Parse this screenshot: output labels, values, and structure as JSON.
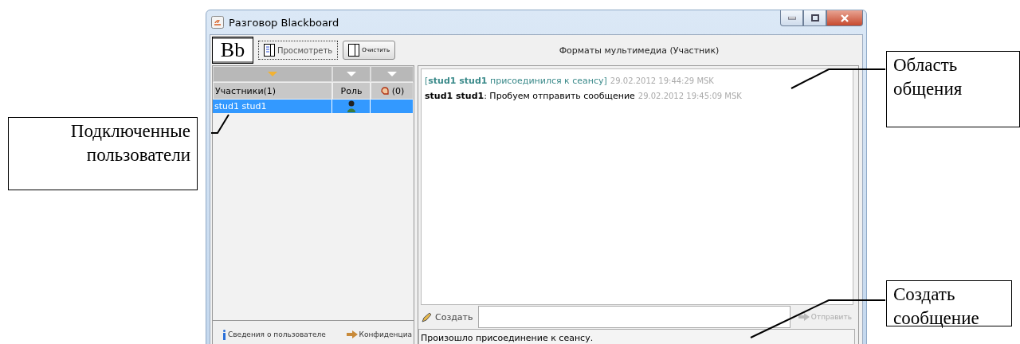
{
  "window": {
    "title": "Разговор Blackboard"
  },
  "toolbar": {
    "logo": "Bb",
    "buttons": [
      {
        "label": "Просмотреть",
        "focused": true
      },
      {
        "label": "Очистить",
        "focused": false
      }
    ],
    "caption": "Форматы мультимедиа (Участник)"
  },
  "participants": {
    "columns": [
      {
        "label": "Участники(1)",
        "sorted": true
      },
      {
        "label": "Роль",
        "sorted": false
      },
      {
        "label": "(0)",
        "sorted": false
      }
    ],
    "rows": [
      {
        "name": "stud1 stud1",
        "selected": true
      }
    ],
    "links": [
      "Сведения о пользователе",
      "Конфиденциа"
    ]
  },
  "chat": {
    "messages": [
      {
        "kind": "system",
        "body": "[**stud1 stud1** присоединился к сеансу]",
        "time": "29.02.2012 19:44:29 MSK"
      },
      {
        "kind": "user",
        "body": "**stud1 stud1**: Пробуем отправить сообщение",
        "time": "29.02.2012 19:45:09 MSK"
      }
    ],
    "create_button": "Создать",
    "send_button": {
      "label": "Отправить",
      "disabled": true
    },
    "status": "Произошло присоединение к сеансу."
  },
  "callouts": [
    {
      "text": "Подключенные пользователи"
    },
    {
      "text": "Область общения"
    },
    {
      "text": "Создать сообщение"
    }
  ]
}
